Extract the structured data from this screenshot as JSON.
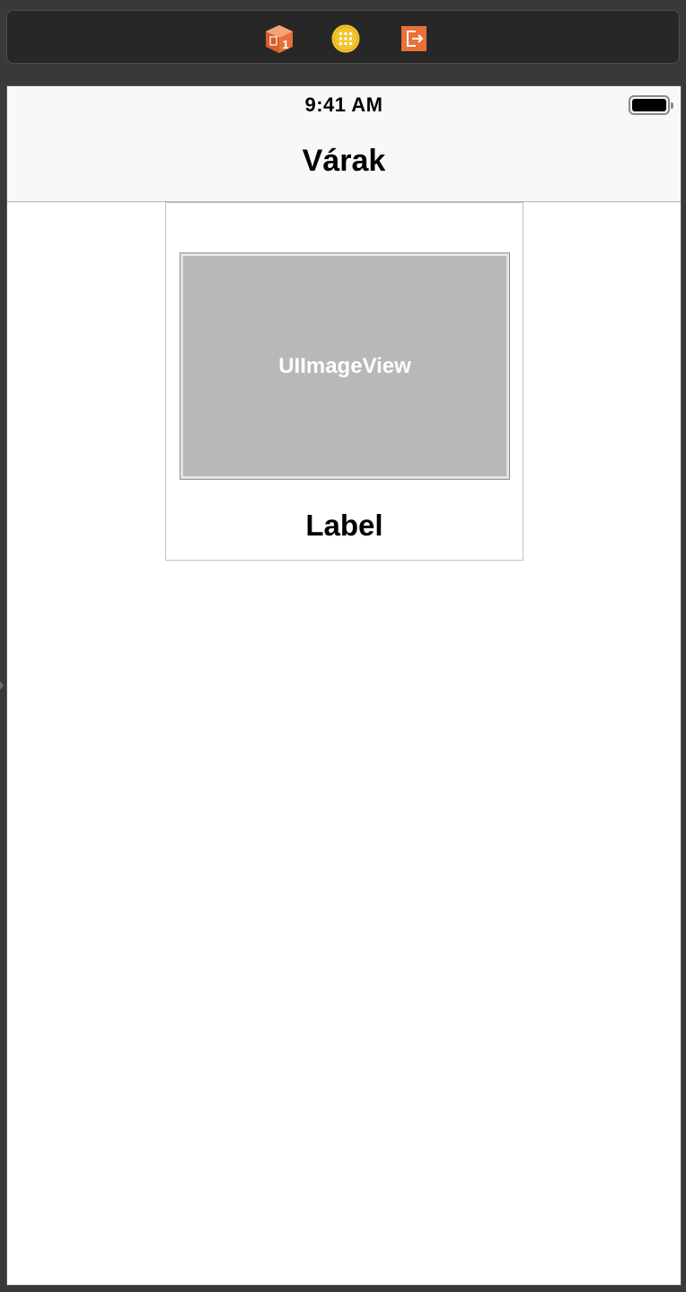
{
  "dock": {
    "icons": [
      {
        "name": "view-controller-icon",
        "glyph": "1",
        "color": "#e8703a"
      },
      {
        "name": "first-responder-icon",
        "color": "#f5c433"
      },
      {
        "name": "exit-icon",
        "color": "#e8703a"
      }
    ]
  },
  "status_bar": {
    "time": "9:41 AM"
  },
  "navbar": {
    "title": "Várak"
  },
  "cell": {
    "image_view_placeholder": "UIImageView",
    "label": "Label"
  }
}
